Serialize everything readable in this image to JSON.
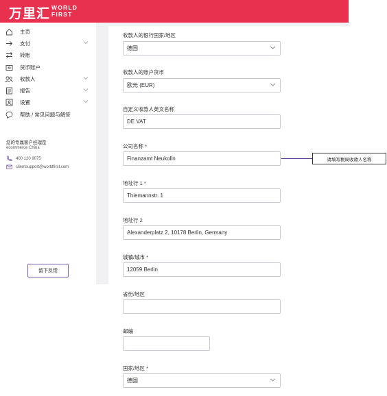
{
  "header": {
    "logo_cn": "万里汇",
    "logo_en_1": "WORLD",
    "logo_en_2": "FIRST",
    "brand_color": "#e8304f"
  },
  "sidebar": {
    "items": [
      {
        "label": "主页",
        "icon": "home-icon"
      },
      {
        "label": "支付",
        "icon": "arrow-right-icon",
        "expandable": true
      },
      {
        "label": "转账",
        "icon": "transfer-icon"
      },
      {
        "label": "货币账户",
        "icon": "wallet-icon"
      },
      {
        "label": "收款人",
        "icon": "users-icon",
        "expandable": true
      },
      {
        "label": "报告",
        "icon": "report-icon",
        "expandable": true
      },
      {
        "label": "设置",
        "icon": "settings-icon",
        "expandable": true
      },
      {
        "label": "帮助 / 常见问题与解答",
        "icon": "help-icon"
      }
    ],
    "manager_title": "您的专属客户经理是",
    "manager_name": "ecommerce China",
    "phone": "400 120 9075",
    "email": "clientsupport@worldfirst.com",
    "feedback_label": "留下反馈"
  },
  "form": {
    "bank_country": {
      "label": "收款人的银行国家/地区",
      "value": "德国"
    },
    "currency": {
      "label": "收款人的账户货币",
      "value": "欧元 (EUR)"
    },
    "nickname": {
      "label": "自定义收款人英文名称",
      "value": "DE VAT"
    },
    "company": {
      "label": "公司名称 *",
      "value": "Finanzamt Neukolln"
    },
    "address1": {
      "label": "地址行 1 *",
      "value": "Thiemannstr. 1"
    },
    "address2": {
      "label": "地址行 2",
      "value": "Alexanderplatz 2, 10178 Berlin, Germany"
    },
    "city": {
      "label": "城镇/城市 *",
      "value": "12059 Berlin"
    },
    "state": {
      "label": "省份/地区",
      "value": ""
    },
    "postcode": {
      "label": "邮编",
      "value": ""
    },
    "country": {
      "label": "国家/地区 *",
      "value": "德国"
    }
  },
  "annotation": {
    "text": "请填写税局收款人名称"
  }
}
